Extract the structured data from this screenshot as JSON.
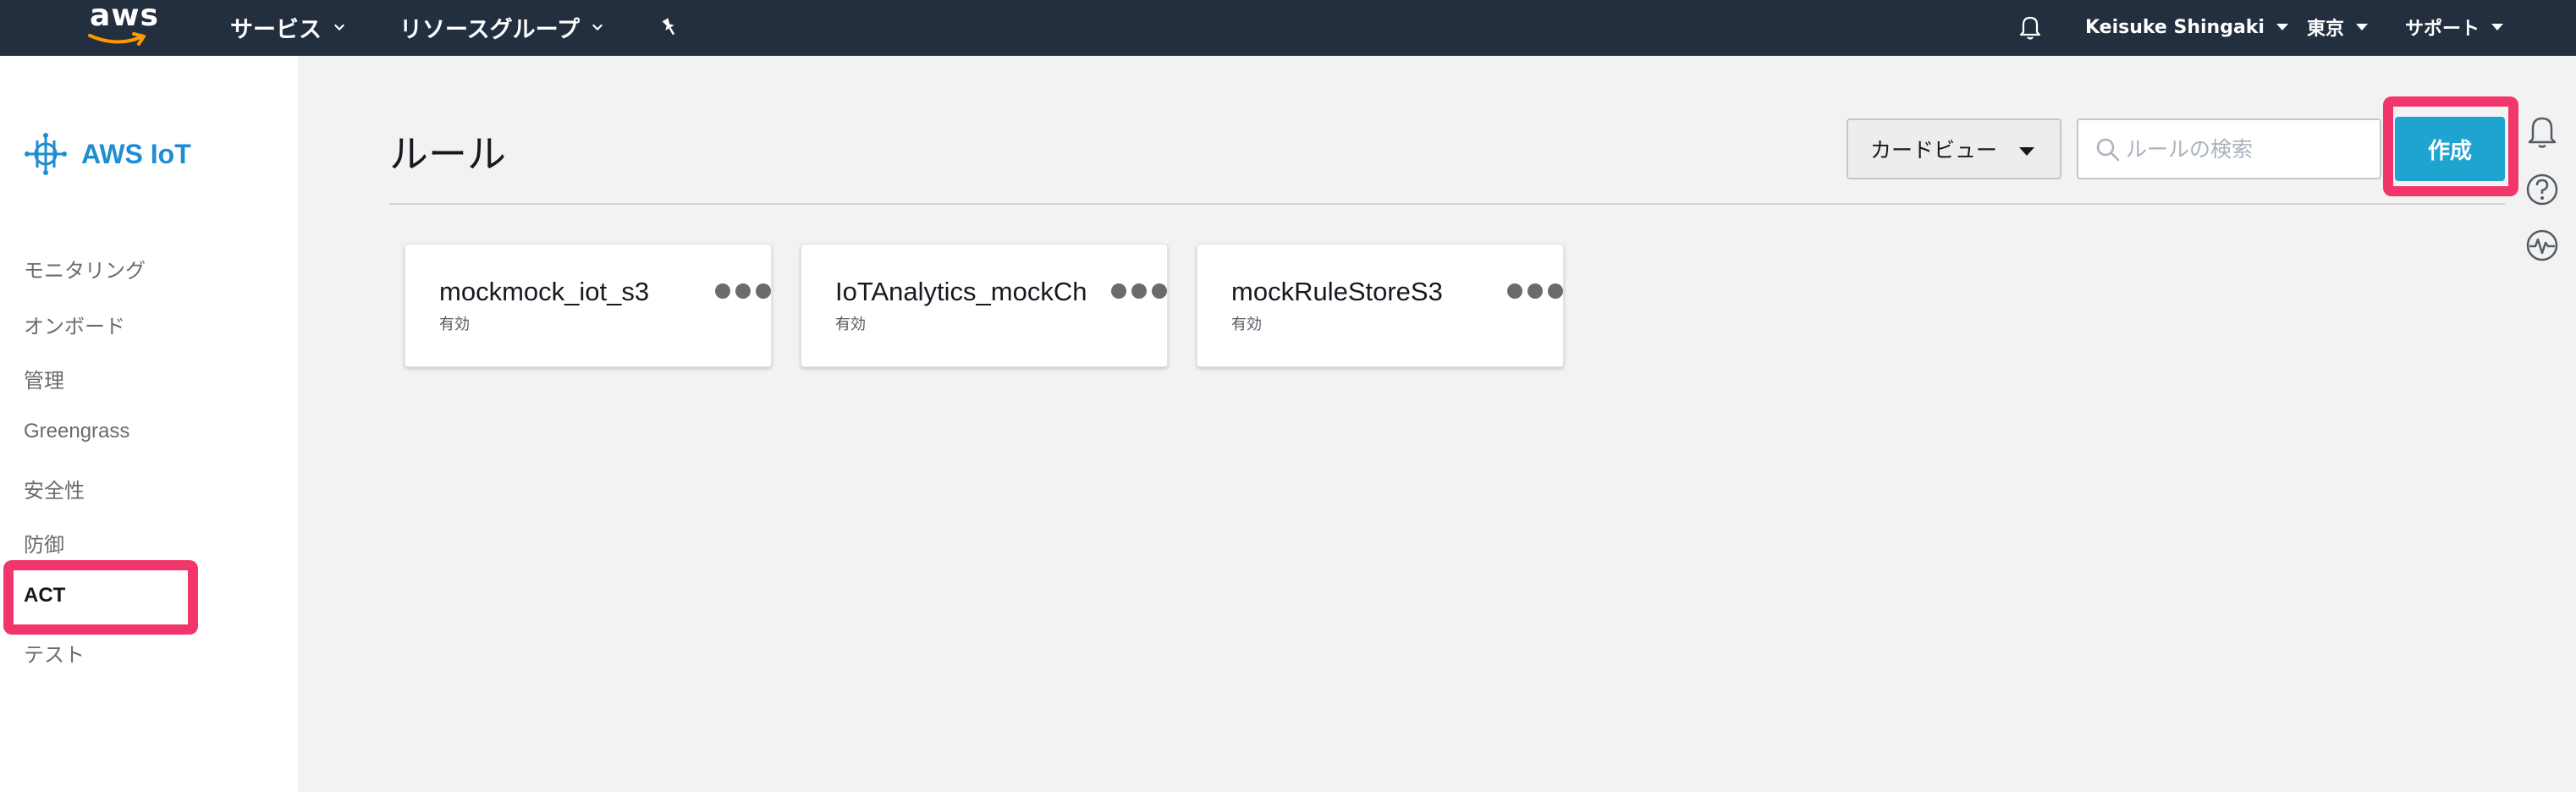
{
  "topnav": {
    "logo_text": "aws",
    "services_label": "サービス",
    "resource_groups_label": "リソースグループ",
    "user_name": "Keisuke Shingaki",
    "region": "東京",
    "support_label": "サポート",
    "icons": {
      "pin": "pin-icon",
      "bell": "bell-icon"
    }
  },
  "sidebar": {
    "brand": "AWS IoT",
    "items": [
      {
        "label": "モニタリング"
      },
      {
        "label": "オンボード"
      },
      {
        "label": "管理"
      },
      {
        "label": "Greengrass"
      },
      {
        "label": "安全性"
      },
      {
        "label": "防御"
      },
      {
        "label": "ACT"
      },
      {
        "label": "テスト"
      }
    ],
    "active_item": "ACT"
  },
  "main": {
    "title": "ルール",
    "view_select": {
      "selected": "カードビュー"
    },
    "search": {
      "placeholder": "ルールの検索",
      "value": ""
    },
    "create_label": "作成",
    "rules": [
      {
        "name": "mockmock_iot_s3",
        "status": "有効"
      },
      {
        "name": "IoTAnalytics_mockCh",
        "status": "有効"
      },
      {
        "name": "mockRuleStoreS3",
        "status": "有効"
      }
    ]
  },
  "right_rail": {
    "icons": [
      "bell-icon",
      "help-icon",
      "activity-icon"
    ]
  },
  "colors": {
    "topbar": "#232f3e",
    "accent": "#1fa4d0",
    "brand": "#1d8ed1",
    "highlight": "#f2366b",
    "background": "#f2f2f2"
  }
}
